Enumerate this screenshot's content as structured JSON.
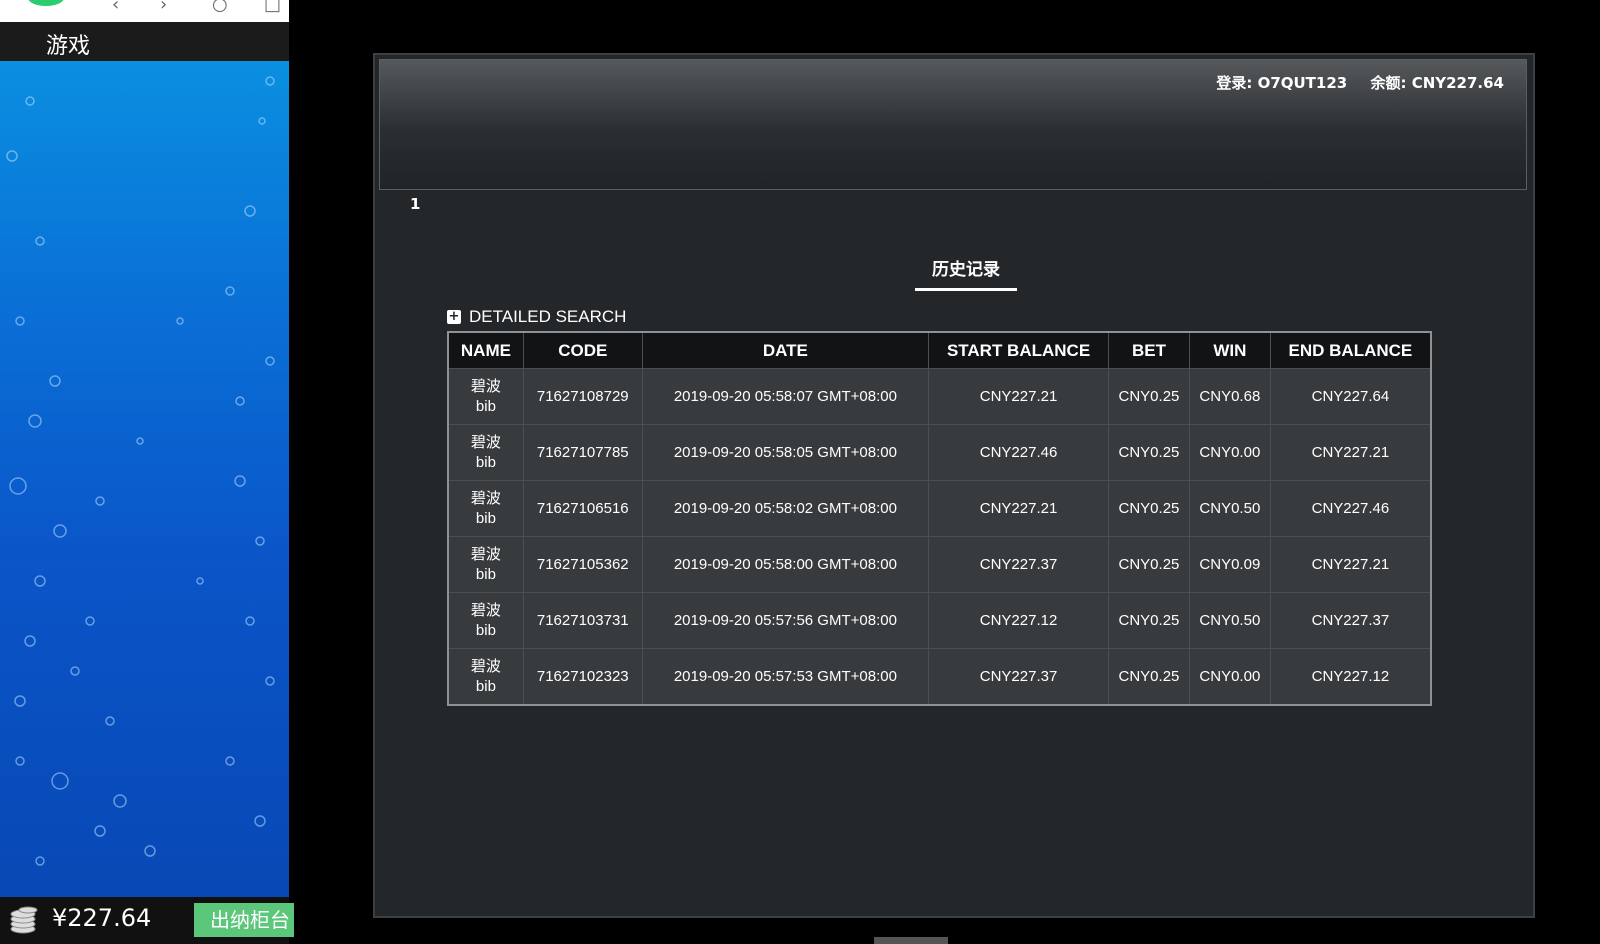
{
  "game_panel": {
    "title": "游戏",
    "balance": "¥227.64",
    "cashier_label": "出纳柜台"
  },
  "header": {
    "login_label": "登录: O7QUT123",
    "balance_label": "余额: CNY227.64"
  },
  "pagination": {
    "current_page": "1"
  },
  "history": {
    "title": "历史记录",
    "detailed_search_label": "DETAILED SEARCH",
    "columns": [
      "NAME",
      "CODE",
      "DATE",
      "START BALANCE",
      "BET",
      "WIN",
      "END BALANCE"
    ],
    "rows": [
      {
        "name_cn": "碧波",
        "name_en": "bib",
        "code": "71627108729",
        "date": "2019-09-20 05:58:07 GMT+08:00",
        "start_balance": "CNY227.21",
        "bet": "CNY0.25",
        "win": "CNY0.68",
        "end_balance": "CNY227.64"
      },
      {
        "name_cn": "碧波",
        "name_en": "bib",
        "code": "71627107785",
        "date": "2019-09-20 05:58:05 GMT+08:00",
        "start_balance": "CNY227.46",
        "bet": "CNY0.25",
        "win": "CNY0.00",
        "end_balance": "CNY227.21"
      },
      {
        "name_cn": "碧波",
        "name_en": "bib",
        "code": "71627106516",
        "date": "2019-09-20 05:58:02 GMT+08:00",
        "start_balance": "CNY227.21",
        "bet": "CNY0.25",
        "win": "CNY0.50",
        "end_balance": "CNY227.46"
      },
      {
        "name_cn": "碧波",
        "name_en": "bib",
        "code": "71627105362",
        "date": "2019-09-20 05:58:00 GMT+08:00",
        "start_balance": "CNY227.37",
        "bet": "CNY0.25",
        "win": "CNY0.09",
        "end_balance": "CNY227.21"
      },
      {
        "name_cn": "碧波",
        "name_en": "bib",
        "code": "71627103731",
        "date": "2019-09-20 05:57:56 GMT+08:00",
        "start_balance": "CNY227.12",
        "bet": "CNY0.25",
        "win": "CNY0.50",
        "end_balance": "CNY227.37"
      },
      {
        "name_cn": "碧波",
        "name_en": "bib",
        "code": "71627102323",
        "date": "2019-09-20 05:57:53 GMT+08:00",
        "start_balance": "CNY227.37",
        "bet": "CNY0.25",
        "win": "CNY0.00",
        "end_balance": "CNY227.12"
      }
    ]
  },
  "icons": {
    "plus": "plus-box-icon",
    "coins": "coin-stack-icon",
    "back": "back-arrow-icon",
    "forward": "forward-arrow-icon",
    "refresh": "refresh-icon"
  },
  "colors": {
    "window_bg": "#23272a",
    "header_row_bg": "#111314",
    "cell_bg": "#373b3e",
    "cashier_button": "#5cc67a",
    "game_water": "#0a6fd6"
  }
}
